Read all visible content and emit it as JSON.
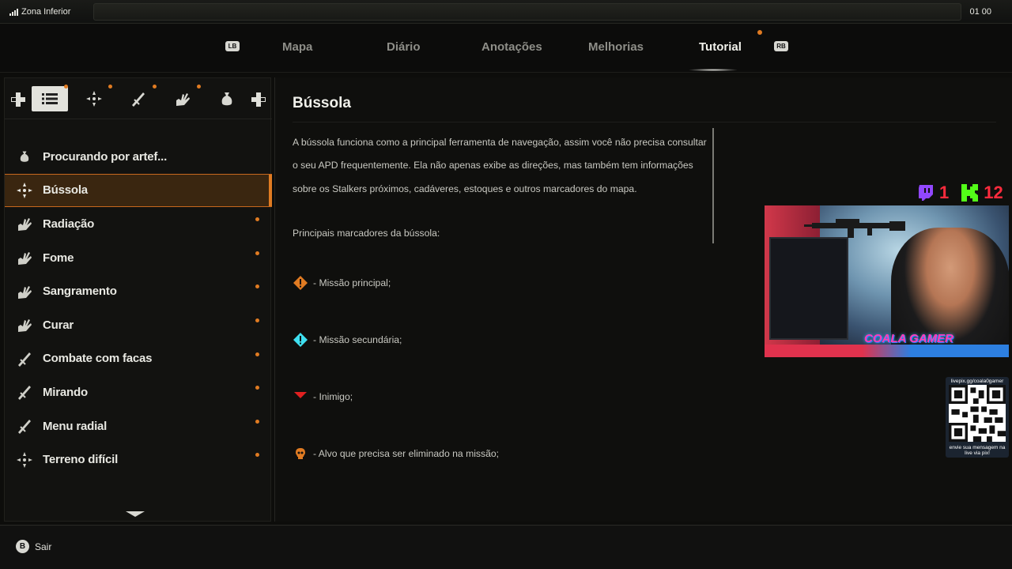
{
  "status": {
    "zone": "Zona Inferior",
    "clock": "01 00"
  },
  "tabs": {
    "left_bumper": "LB",
    "right_bumper": "RB",
    "items": [
      {
        "label": "Mapa"
      },
      {
        "label": "Diário"
      },
      {
        "label": "Anotações"
      },
      {
        "label": "Melhorias"
      },
      {
        "label": "Tutorial",
        "active": true,
        "has_notification": true
      }
    ]
  },
  "filters": {
    "icons": [
      "list-icon",
      "crosshair-icon",
      "knife-icon",
      "crossed-swords-icon",
      "bag-icon"
    ],
    "active_index": 0
  },
  "list": {
    "items": [
      {
        "icon": "bag-icon",
        "label": "Procurando por artef...",
        "new": false
      },
      {
        "icon": "compass-icon",
        "label": "Bússola",
        "new": false,
        "selected": true
      },
      {
        "icon": "hand-icon",
        "label": "Radiação",
        "new": true
      },
      {
        "icon": "hand-icon",
        "label": "Fome",
        "new": true
      },
      {
        "icon": "hand-icon",
        "label": "Sangramento",
        "new": true
      },
      {
        "icon": "hand-icon",
        "label": "Curar",
        "new": true
      },
      {
        "icon": "knife-icon",
        "label": "Combate com facas",
        "new": true
      },
      {
        "icon": "knife-icon",
        "label": "Mirando",
        "new": true
      },
      {
        "icon": "knife-icon",
        "label": "Menu radial",
        "new": true
      },
      {
        "icon": "compass-icon",
        "label": "Terreno difícil",
        "new": true
      }
    ]
  },
  "content": {
    "title": "Bússola",
    "paragraph": "A bússola funciona como a principal ferramenta de navegação, assim você não precisa consultar o seu APD frequentemente. Ela não apenas exibe as direções, mas também tem informações sobre os Stalkers próximos, cadáveres, estoques e outros marcadores do mapa.",
    "subheading": "Principais marcadores da bússola:",
    "markers": [
      {
        "icon": "orange-diamond-icon",
        "text": "- Missão principal;"
      },
      {
        "icon": "cyan-diamond-icon",
        "text": "- Missão secundária;"
      },
      {
        "icon": "red-triangle-icon",
        "text": "- Inimigo;"
      },
      {
        "icon": "skull-icon",
        "text": "- Alvo que precisa ser eliminado na missão;"
      }
    ]
  },
  "footer": {
    "button": "B",
    "label": "Sair"
  },
  "overlay": {
    "twitch_count": "1",
    "kick_count": "12",
    "brand": "COALA GAMER",
    "qr_top": "livepix.gg/coala0gamer",
    "qr_bottom": "envie sua mensagem na live via pix!"
  },
  "colors": {
    "accent": "#e07b22",
    "selected_bg": "#3a2610",
    "active_tab": "#f2f2ec",
    "inactive_tab": "#8e8e88"
  }
}
